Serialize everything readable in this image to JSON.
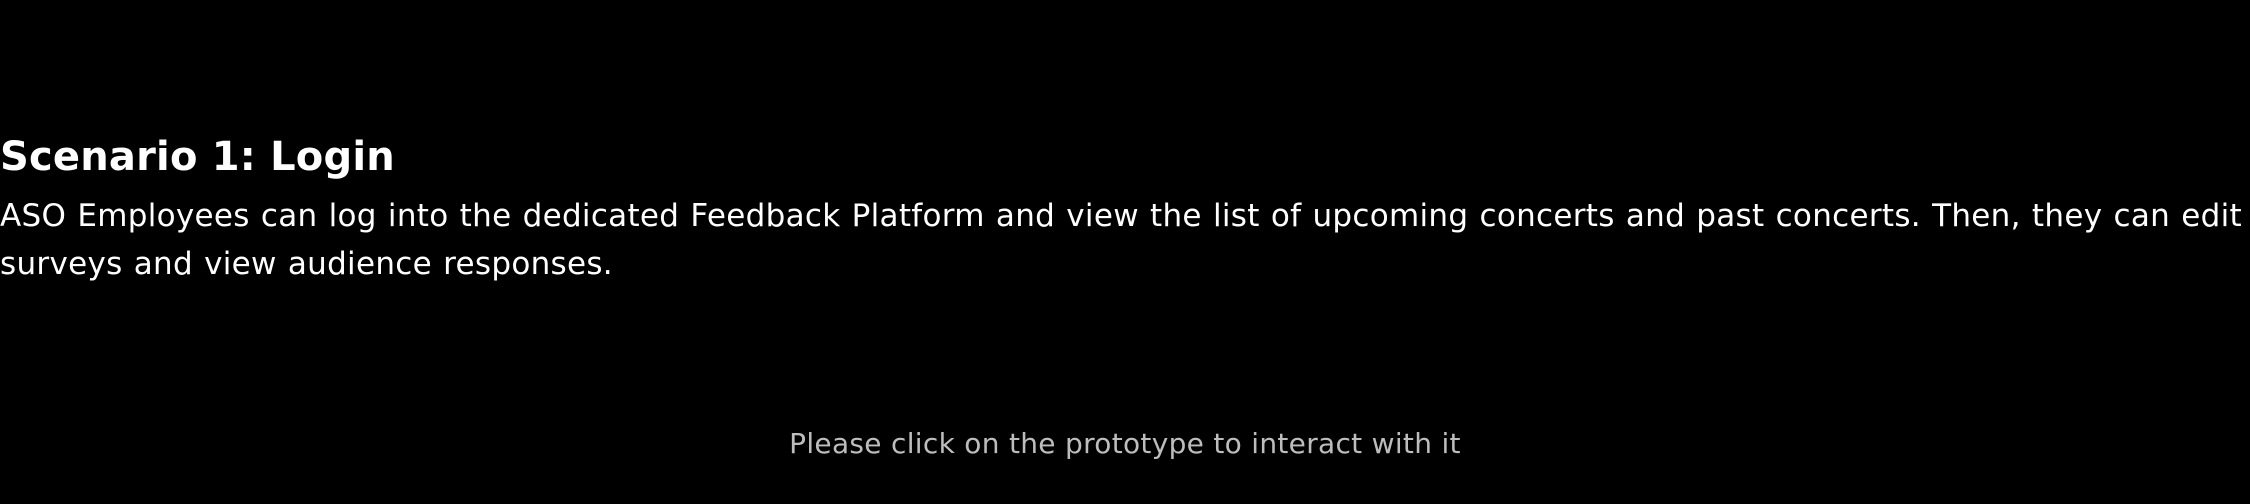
{
  "scenario": {
    "title": "Scenario 1: Login",
    "description": "ASO Employees can log into the dedicated Feedback Platform and view the list of upcoming concerts and past concerts. Then, they can edit surveys and view audience responses."
  },
  "hint": {
    "text": "Please click on the prototype to interact with it"
  },
  "colors": {
    "background": "#000000",
    "text": "#ffffff",
    "hint_text": "#bdbdbd"
  }
}
